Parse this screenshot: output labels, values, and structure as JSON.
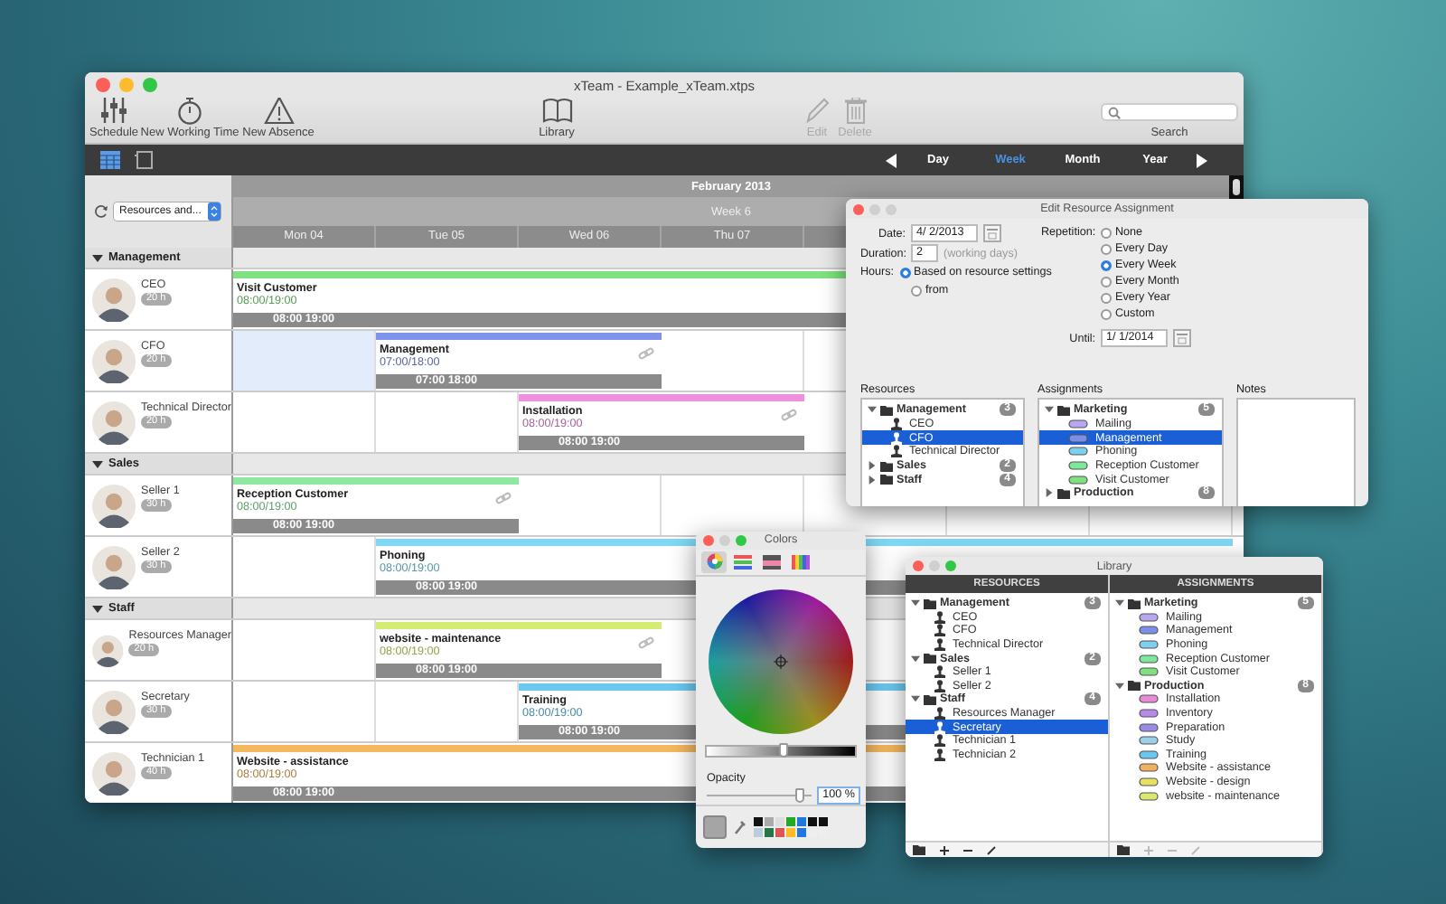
{
  "window": {
    "title": "xTeam - Example_xTeam.xtps"
  },
  "toolbar": {
    "schedule": {
      "label": "Schedule"
    },
    "new_working_time": {
      "label": "New Working Time"
    },
    "new_absence": {
      "label": "New Absence"
    },
    "library": {
      "label": "Library"
    },
    "edit": {
      "label": "Edit",
      "disabled": true
    },
    "delete": {
      "label": "Delete",
      "disabled": true
    },
    "search": {
      "label": "Search"
    }
  },
  "view_switch": [
    {
      "selected": true
    },
    {
      "selected": false
    }
  ],
  "periods": [
    {
      "label": "Day",
      "selected": false
    },
    {
      "label": "Week",
      "selected": true
    },
    {
      "label": "Month",
      "selected": false
    },
    {
      "label": "Year",
      "selected": false
    }
  ],
  "calendar": {
    "filter": "Resources and...",
    "month": "February 2013",
    "week": "Week 6",
    "days": [
      "Mon 04",
      "Tue 05",
      "Wed 06",
      "Thu 07"
    ],
    "groups": [
      {
        "name": "Management",
        "expanded": true,
        "resources": [
          {
            "name": "CEO",
            "hours": "20 h",
            "selected": false,
            "event": {
              "title": "Visit Customer",
              "time": "08:00/19:00",
              "span": "08:00 19:00",
              "color": "#7ee27e",
              "linked": false
            }
          },
          {
            "name": "CFO",
            "hours": "20 h",
            "selected": true,
            "event": {
              "title": "Management",
              "time": "07:00/18:00",
              "span": "07:00 18:00",
              "color": "#7f93ea",
              "linked": true
            }
          },
          {
            "name": "Technical Director",
            "hours": "20 h",
            "selected": false,
            "event": {
              "title": "Installation",
              "time": "08:00/19:00",
              "span": "08:00 19:00",
              "color": "#f08ee0",
              "linked": true
            }
          }
        ]
      },
      {
        "name": "Sales",
        "expanded": true,
        "resources": [
          {
            "name": "Seller 1",
            "hours": "30 h",
            "selected": false,
            "event": {
              "title": "Reception Customer",
              "time": "08:00/19:00",
              "span": "08:00 19:00",
              "color": "#8ee8a0",
              "linked": true
            }
          },
          {
            "name": "Seller 2",
            "hours": "30 h",
            "selected": false,
            "event": {
              "title": "Phoning",
              "time": "08:00/19:00",
              "span": "08:00 19:00",
              "color": "#80d8f4",
              "linked": false
            }
          }
        ]
      },
      {
        "name": "Staff",
        "expanded": true,
        "resources": [
          {
            "name": "Resources Manager",
            "hours": "20 h",
            "selected": false,
            "event": {
              "title": "website - maintenance",
              "time": "08:00/19:00",
              "span": "08:00 19:00",
              "color": "#d4ec74",
              "linked": true
            }
          },
          {
            "name": "Secretary",
            "hours": "30 h",
            "selected": false,
            "event": {
              "title": "Training",
              "time": "08:00/19:00",
              "span": "08:00 19:00",
              "color": "#6cc8f0",
              "linked": false
            }
          },
          {
            "name": "Technician 1",
            "hours": "40 h",
            "selected": false,
            "event": {
              "title": "Website - assistance",
              "time": "08:00/19:00",
              "span": "08:00 19:00",
              "color": "#f4b860",
              "linked": false
            }
          }
        ]
      }
    ]
  },
  "edit_dialog": {
    "title": "Edit Resource Assignment",
    "date_label": "Date:",
    "date": "4/ 2/2013",
    "duration_label": "Duration:",
    "duration": "2",
    "duration_unit": "(working days)",
    "hours_label": "Hours:",
    "hours_options": [
      {
        "label": "Based on resource settings",
        "selected": true
      },
      {
        "label": "from",
        "selected": false
      }
    ],
    "repetition_label": "Repetition:",
    "repetition_options": [
      {
        "label": "None",
        "selected": false
      },
      {
        "label": "Every Day",
        "selected": false
      },
      {
        "label": "Every Week",
        "selected": true
      },
      {
        "label": "Every Month",
        "selected": false
      },
      {
        "label": "Every Year",
        "selected": false
      },
      {
        "label": "Custom",
        "selected": false
      }
    ],
    "until_label": "Until:",
    "until": "1/ 1/2014",
    "resources_label": "Resources",
    "resources": [
      {
        "name": "Management",
        "count": "3",
        "expanded": true,
        "selected": false,
        "children": [
          {
            "name": "CEO",
            "selected": false
          },
          {
            "name": "CFO",
            "selected": true
          },
          {
            "name": "Technical Director",
            "selected": false
          }
        ]
      },
      {
        "name": "Sales",
        "count": "2",
        "expanded": false,
        "selected": false
      },
      {
        "name": "Staff",
        "count": "4",
        "expanded": false,
        "selected": false
      }
    ],
    "assignments_label": "Assignments",
    "assignments": [
      {
        "name": "Marketing",
        "count": "5",
        "expanded": true,
        "selected": false,
        "children": [
          {
            "name": "Mailing",
            "color": "#b9a8f0",
            "selected": false
          },
          {
            "name": "Management",
            "color": "#7b8fe8",
            "selected": true
          },
          {
            "name": "Phoning",
            "color": "#7dd0f0",
            "selected": false
          },
          {
            "name": "Reception Customer",
            "color": "#7ee89a",
            "selected": false
          },
          {
            "name": "Visit Customer",
            "color": "#80e080",
            "selected": false
          }
        ]
      },
      {
        "name": "Production",
        "count": "8",
        "expanded": false,
        "selected": false
      }
    ],
    "notes_label": "Notes"
  },
  "colors_panel": {
    "title": "Colors",
    "tabs": [
      {
        "selected": true
      },
      {
        "selected": false
      },
      {
        "selected": false
      },
      {
        "selected": false
      }
    ],
    "brightness": {
      "level": 0.55
    },
    "opacity_label": "Opacity",
    "opacity": {
      "level": 0.97
    },
    "opacity_value": "100 %"
  },
  "library": {
    "title": "Library",
    "resources_header": "RESOURCES",
    "assignments_header": "ASSIGNMENTS",
    "resources": [
      {
        "name": "Management",
        "count": "3",
        "expanded": true,
        "selected": false,
        "children": [
          {
            "name": "CEO",
            "selected": false
          },
          {
            "name": "CFO",
            "selected": false
          },
          {
            "name": "Technical Director",
            "selected": false
          }
        ]
      },
      {
        "name": "Sales",
        "count": "2",
        "expanded": true,
        "selected": false,
        "children": [
          {
            "name": "Seller 1",
            "selected": false
          },
          {
            "name": "Seller 2",
            "selected": false
          }
        ]
      },
      {
        "name": "Staff",
        "count": "4",
        "expanded": true,
        "selected": false,
        "children": [
          {
            "name": "Resources Manager",
            "selected": false
          },
          {
            "name": "Secretary",
            "selected": true
          },
          {
            "name": "Technician 1",
            "selected": false
          },
          {
            "name": "Technician 2",
            "selected": false
          }
        ]
      }
    ],
    "assignments": [
      {
        "name": "Marketing",
        "count": "5",
        "expanded": true,
        "selected": false,
        "children": [
          {
            "name": "Mailing",
            "color": "#b9a8f0",
            "selected": false
          },
          {
            "name": "Management",
            "color": "#7b8fe8",
            "selected": false
          },
          {
            "name": "Phoning",
            "color": "#7dd0f0",
            "selected": false
          },
          {
            "name": "Reception Customer",
            "color": "#7ee89a",
            "selected": false
          },
          {
            "name": "Visit Customer",
            "color": "#80e080",
            "selected": false
          }
        ]
      },
      {
        "name": "Production",
        "count": "8",
        "expanded": true,
        "selected": false,
        "children": [
          {
            "name": "Installation",
            "color": "#e88ad8",
            "selected": false
          },
          {
            "name": "Inventory",
            "color": "#b58ae8",
            "selected": false
          },
          {
            "name": "Preparation",
            "color": "#9a8ae8",
            "selected": false
          },
          {
            "name": "Study",
            "color": "#9ad0e8",
            "selected": false
          },
          {
            "name": "Training",
            "color": "#6ac8f0",
            "selected": false
          },
          {
            "name": "Website - assistance",
            "color": "#f0b060",
            "selected": false
          },
          {
            "name": "Website - design",
            "color": "#e8e060",
            "selected": false
          },
          {
            "name": "website - maintenance",
            "color": "#d8e870",
            "selected": false
          }
        ]
      }
    ]
  }
}
